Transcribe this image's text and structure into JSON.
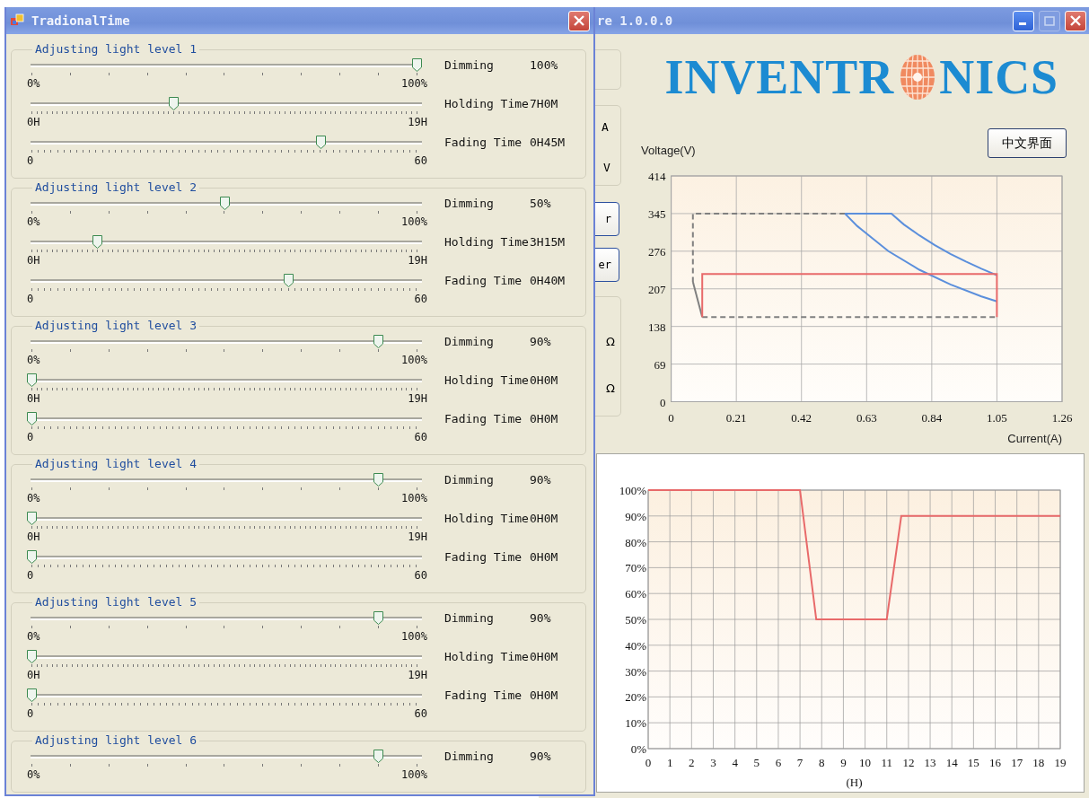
{
  "main_window": {
    "title": "re 1.0.0.0",
    "partial_labels": [
      "A",
      "V"
    ],
    "partial_buttons": [
      "r",
      "er"
    ],
    "units": [
      "Ω",
      "Ω"
    ],
    "logo": {
      "text_left": "INVENTR",
      "text_right": "NICS"
    },
    "language_button": "中文界面",
    "voltage_chart": {
      "chart_data": {
        "type": "line",
        "xlabel": "Current(A)",
        "ylabel": "Voltage(V)",
        "xlim": [
          0,
          1.26
        ],
        "ylim": [
          0,
          414
        ],
        "grid": true,
        "xticks": [
          0,
          0.21,
          0.42,
          0.63,
          0.84,
          1.05,
          1.26
        ],
        "yticks": [
          0,
          69,
          138,
          207,
          276,
          345,
          414
        ],
        "series": [
          {
            "color": "#808080",
            "line_style": "dashed",
            "x": [
              0.56,
              0.07,
              0.07
            ],
            "values": [
              345,
              345,
              220
            ]
          },
          {
            "color": "#808080",
            "line_style": "solid",
            "x": [
              0.07,
              0.1
            ],
            "values": [
              220,
              155
            ]
          },
          {
            "color": "#808080",
            "line_style": "dashed",
            "x": [
              0.1,
              1.05
            ],
            "values": [
              155,
              155
            ]
          },
          {
            "color": "#5b8fdc",
            "line_style": "solid",
            "x": [
              0.56,
              0.6,
              0.7,
              0.8,
              0.9,
              1.0,
              1.05
            ],
            "values": [
              345,
              322,
              276,
              242,
              215,
              193,
              184
            ]
          },
          {
            "color": "#5b8fdc",
            "line_style": "solid",
            "x": [
              0.56,
              0.71,
              0.75,
              0.8,
              0.85,
              0.9,
              0.95,
              1.0,
              1.05
            ],
            "values": [
              345,
              345,
              325,
              305,
              287,
              271,
              257,
              244,
              232
            ]
          },
          {
            "color": "#e86a6a",
            "line_style": "solid",
            "x": [
              0.1,
              0.1,
              1.05,
              1.05
            ],
            "values": [
              155,
              234,
              234,
              155
            ]
          }
        ]
      }
    },
    "timing_chart": {
      "chart_data": {
        "type": "line",
        "xlabel": "(H)",
        "xlim": [
          0,
          19
        ],
        "ylim": [
          0,
          100
        ],
        "grid": true,
        "xticks": [
          0,
          1,
          2,
          3,
          4,
          5,
          6,
          7,
          8,
          9,
          10,
          11,
          12,
          13,
          14,
          15,
          16,
          17,
          18,
          19
        ],
        "yticks": [
          {
            "value": 0,
            "label": "0%"
          },
          {
            "value": 10,
            "label": "10%"
          },
          {
            "value": 20,
            "label": "20%"
          },
          {
            "value": 30,
            "label": "30%"
          },
          {
            "value": 40,
            "label": "40%"
          },
          {
            "value": 50,
            "label": "50%"
          },
          {
            "value": 60,
            "label": "60%"
          },
          {
            "value": 70,
            "label": "70%"
          },
          {
            "value": 80,
            "label": "80%"
          },
          {
            "value": 90,
            "label": "90%"
          },
          {
            "value": 100,
            "label": "100%"
          }
        ],
        "series": [
          {
            "color": "#e86a6a",
            "line_style": "solid",
            "x": [
              0,
              7,
              7.75,
              11,
              11.67,
              19
            ],
            "values": [
              100,
              100,
              50,
              50,
              90,
              90
            ]
          }
        ]
      }
    }
  },
  "dialog": {
    "title": "TradionalTime",
    "groups": [
      {
        "title": "Adjusting light level 1",
        "sliders": [
          {
            "kind": "dimming",
            "label": "Dimming",
            "value": "100%",
            "level": 1,
            "min": "0%",
            "max": "100%"
          },
          {
            "kind": "holding",
            "label": "Holding Time",
            "value": "7H0M",
            "level": 0.368,
            "min": "0H",
            "max": "19H"
          },
          {
            "kind": "fading",
            "label": "Fading Time",
            "value": "0H45M",
            "level": 0.75,
            "min": "0",
            "max": "60"
          }
        ]
      },
      {
        "title": "Adjusting light level 2",
        "sliders": [
          {
            "kind": "dimming",
            "label": "Dimming",
            "value": "50%",
            "level": 0.5,
            "min": "0%",
            "max": "100%"
          },
          {
            "kind": "holding",
            "label": "Holding Time",
            "value": "3H15M",
            "level": 0.171,
            "min": "0H",
            "max": "19H"
          },
          {
            "kind": "fading",
            "label": "Fading Time",
            "value": "0H40M",
            "level": 0.667,
            "min": "0",
            "max": "60"
          }
        ]
      },
      {
        "title": "Adjusting light level 3",
        "sliders": [
          {
            "kind": "dimming",
            "label": "Dimming",
            "value": "90%",
            "level": 0.9,
            "min": "0%",
            "max": "100%"
          },
          {
            "kind": "holding",
            "label": "Holding Time",
            "value": "0H0M",
            "level": 0,
            "min": "0H",
            "max": "19H"
          },
          {
            "kind": "fading",
            "label": "Fading Time",
            "value": "0H0M",
            "level": 0,
            "min": "0",
            "max": "60"
          }
        ]
      },
      {
        "title": "Adjusting light level 4",
        "sliders": [
          {
            "kind": "dimming",
            "label": "Dimming",
            "value": "90%",
            "level": 0.9,
            "min": "0%",
            "max": "100%"
          },
          {
            "kind": "holding",
            "label": "Holding Time",
            "value": "0H0M",
            "level": 0,
            "min": "0H",
            "max": "19H"
          },
          {
            "kind": "fading",
            "label": "Fading Time",
            "value": "0H0M",
            "level": 0,
            "min": "0",
            "max": "60"
          }
        ]
      },
      {
        "title": "Adjusting light level 5",
        "sliders": [
          {
            "kind": "dimming",
            "label": "Dimming",
            "value": "90%",
            "level": 0.9,
            "min": "0%",
            "max": "100%"
          },
          {
            "kind": "holding",
            "label": "Holding Time",
            "value": "0H0M",
            "level": 0,
            "min": "0H",
            "max": "19H"
          },
          {
            "kind": "fading",
            "label": "Fading Time",
            "value": "0H0M",
            "level": 0,
            "min": "0",
            "max": "60"
          }
        ]
      },
      {
        "title": "Adjusting light level 6",
        "sliders": [
          {
            "kind": "dimming",
            "label": "Dimming",
            "value": "90%",
            "level": 0.9,
            "min": "0%",
            "max": "100%"
          }
        ]
      }
    ]
  }
}
